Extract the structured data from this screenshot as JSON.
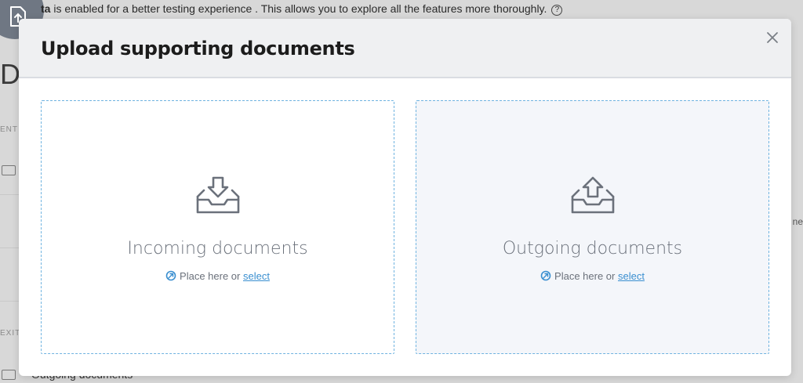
{
  "background": {
    "banner_bold": "ta",
    "banner_text": " is enabled for a better testing experience . This allows you to explore all the features more thoroughly.",
    "banner_help_icon": "question-circle-icon",
    "heading_fragment": "D",
    "label_top": "ENT",
    "label_bottom": "EXIT",
    "right_fragment": "ne",
    "bottom_row_text": "Outgoing documents"
  },
  "modal": {
    "title": "Upload supporting documents",
    "close_icon": "close-icon",
    "zones": {
      "incoming": {
        "title": "Incoming documents",
        "hint": "Place here or",
        "select": "select",
        "icon": "inbox-download-icon"
      },
      "outgoing": {
        "title": "Outgoing documents",
        "hint": "Place here or",
        "select": "select",
        "icon": "inbox-upload-icon"
      }
    }
  },
  "colors": {
    "accent": "#3a8fd0",
    "dropzone_border": "#6fb3e0",
    "header_bg": "#eff0f2"
  }
}
